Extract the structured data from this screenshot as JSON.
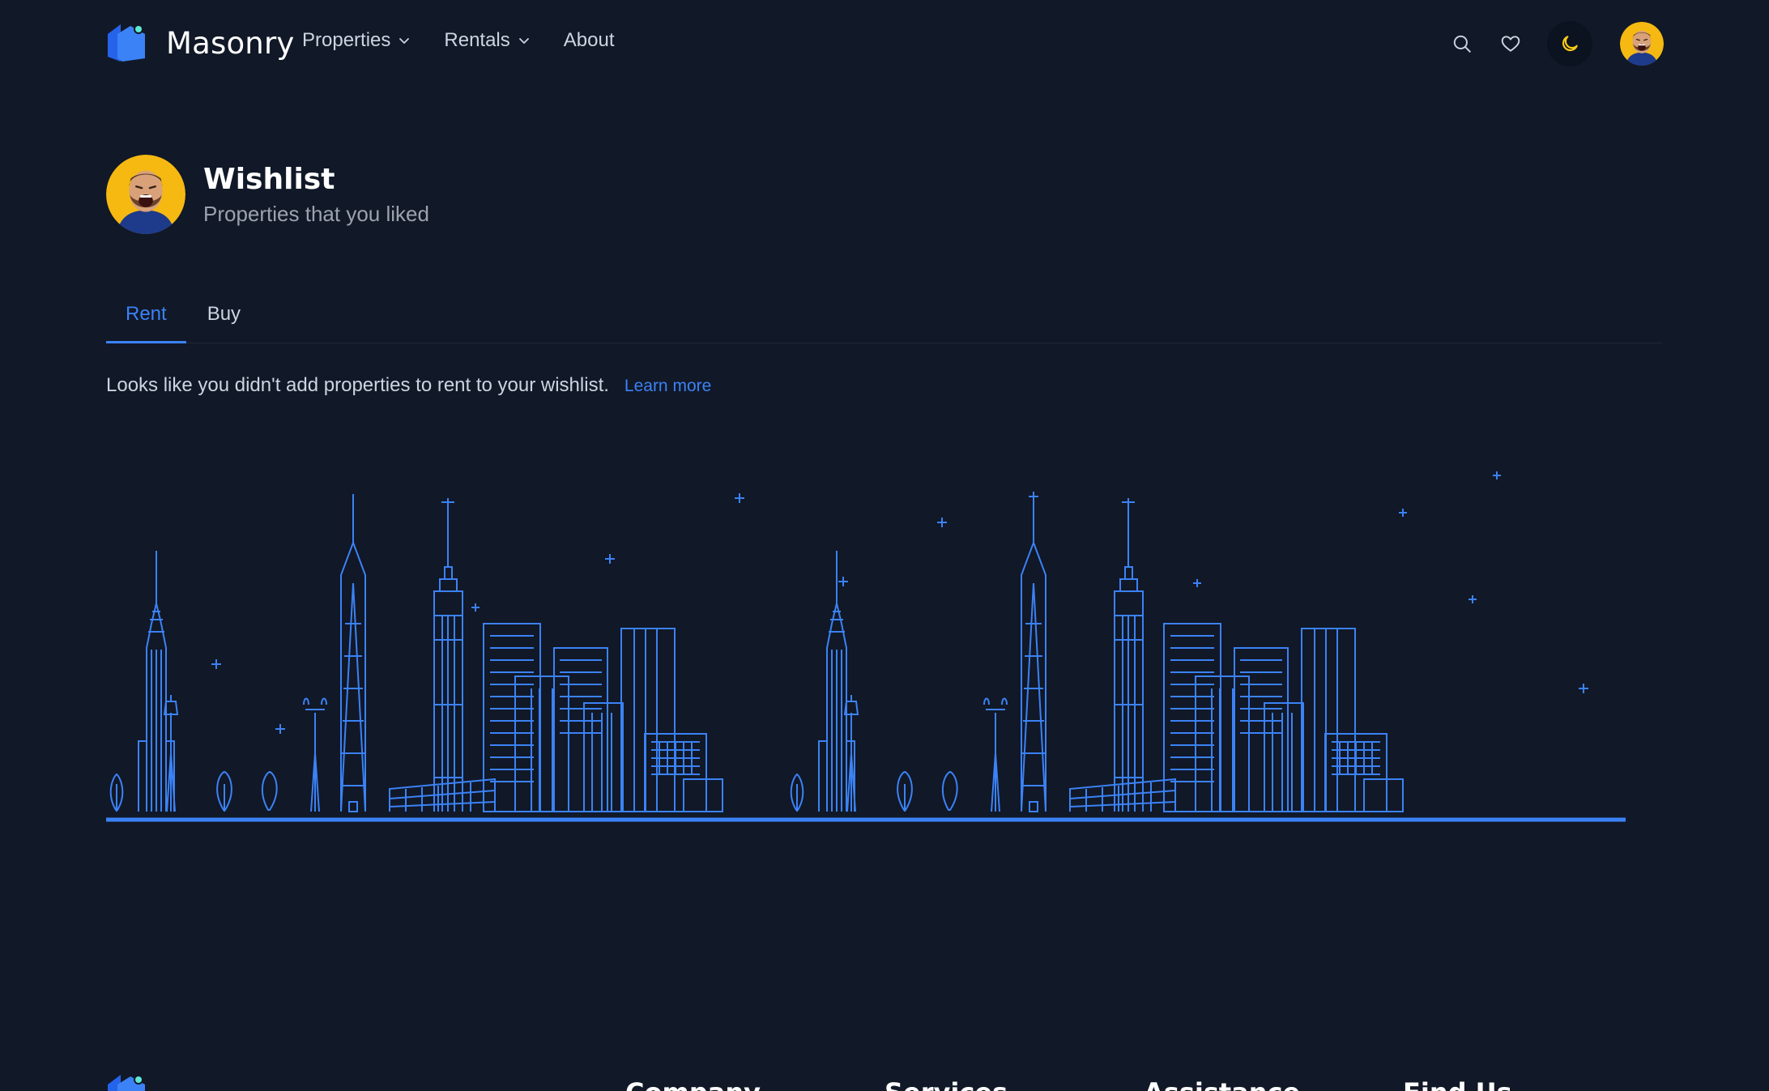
{
  "brand": {
    "name": "Masonry"
  },
  "nav": {
    "items": [
      {
        "label": "Properties",
        "has_dropdown": true
      },
      {
        "label": "Rentals",
        "has_dropdown": true
      },
      {
        "label": "About",
        "has_dropdown": false
      }
    ]
  },
  "header_actions": {
    "icons": [
      "search-icon",
      "heart-icon",
      "moon-icon"
    ]
  },
  "profile": {
    "title": "Wishlist",
    "subtitle": "Properties that you liked"
  },
  "tabs": [
    {
      "label": "Rent",
      "active": true
    },
    {
      "label": "Buy",
      "active": false
    }
  ],
  "empty_state": {
    "message": "Looks like you didn't add properties to rent to your wishlist.",
    "link": "Learn more"
  },
  "footer": {
    "columns": [
      "Company",
      "Services",
      "Assistance",
      "Find Us"
    ]
  },
  "colors": {
    "background": "#111827",
    "accent": "#3b82f6",
    "moon": "#facc15",
    "avatar_bg": "#f5b912"
  }
}
